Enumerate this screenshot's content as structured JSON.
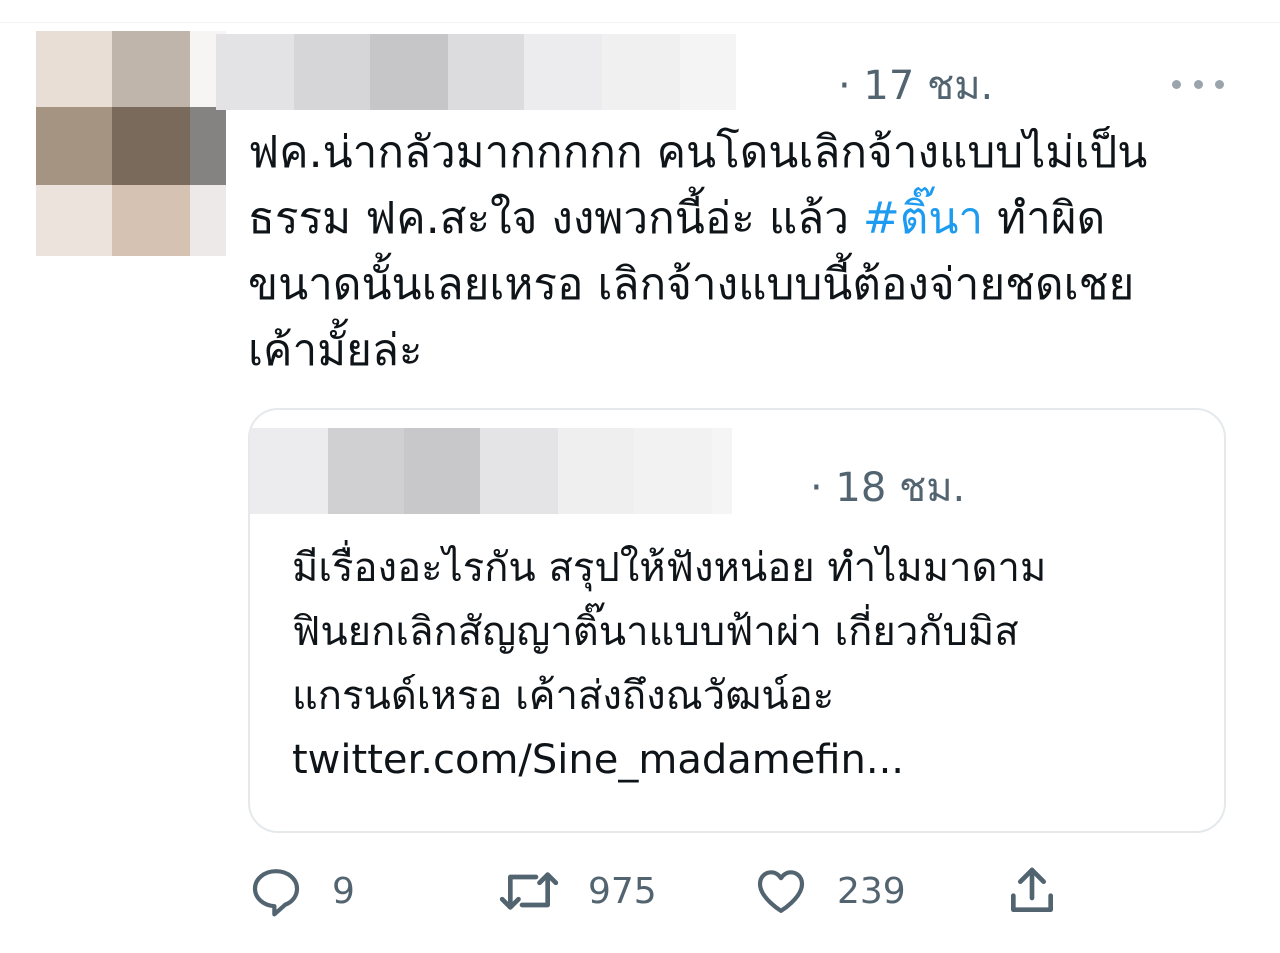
{
  "tweet": {
    "time": "· 17 ชม.",
    "text_part1": "ฟค.น่ากลัวมากกกกก คนโดนเลิกจ้างแบบไม่เป็น\nธรรม ฟค.สะใจ งงพวกนี้อ่ะ แล้ว ",
    "hashtag": "#ติ๊นา",
    "text_part2": " ทำผิด\nขนาดนั้นเลยเหรอ เลิกจ้างแบบนี้ต้องจ่ายชดเชย\nเค้ามั้ยล่ะ",
    "more_icon": "more-horizontal-icon"
  },
  "quoted_tweet": {
    "time": "· 18 ชม.",
    "text": "มีเรื่องอะไรกัน สรุปให้ฟังหน่อย ทำไมมาดาม\nฟินยกเลิกสัญญาติ๊นาแบบฟ้าผ่า เกี่ยวกับมิส\nแกรนด์เหรอ เค้าส่งถึงณวัฒน์อะ\n",
    "link": "twitter.com/Sine_madamefin..."
  },
  "actions": {
    "reply_count": "9",
    "retweet_count": "975",
    "like_count": "239",
    "icons": [
      "reply-icon",
      "retweet-icon",
      "like-icon",
      "share-icon"
    ]
  },
  "colors": {
    "hashtag": "#1d9bf0",
    "secondary_text": "#536471",
    "border": "#e5e9ec"
  }
}
